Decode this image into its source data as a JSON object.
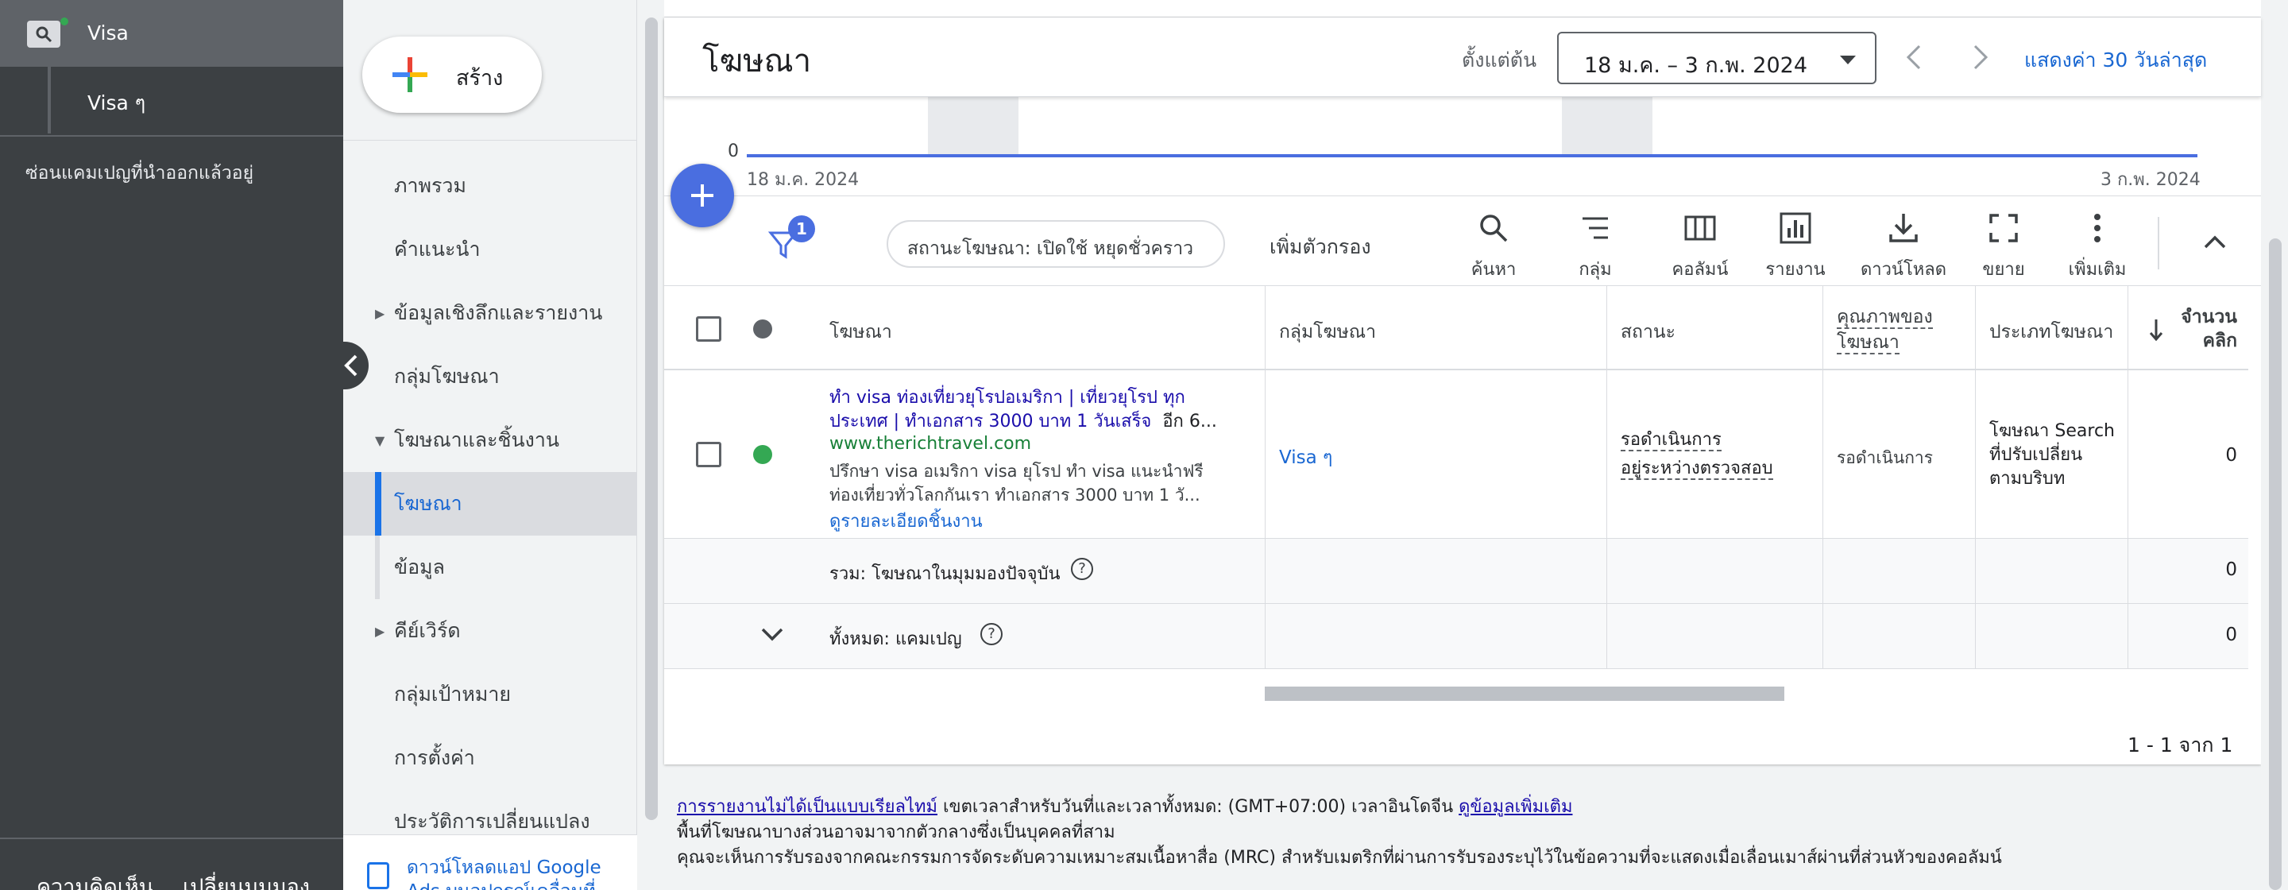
{
  "left_panel": {
    "campaign_label": "Visa",
    "adgroup_label": "Visa ๆ",
    "hide_removed": "ซ่อนแคมเปญที่นำออกแล้วอยู่",
    "feedback": "ความคิดเห็น",
    "switch_view": "เปลี่ยนมุมมอง"
  },
  "nav": {
    "create_label": "สร้าง",
    "items": [
      {
        "label": "ภาพรวม"
      },
      {
        "label": "คำแนะนำ"
      },
      {
        "label": "ข้อมูลเชิงลึกและรายงาน"
      },
      {
        "label": "กลุ่มโฆษณา"
      },
      {
        "label": "โฆษณาและชิ้นงาน"
      },
      {
        "label": "โฆษณา"
      },
      {
        "label": "ข้อมูล"
      },
      {
        "label": "คีย์เวิร์ด"
      },
      {
        "label": "กลุ่มเป้าหมาย"
      },
      {
        "label": "การตั้งค่า"
      },
      {
        "label": "ประวัติการเปลี่ยนแปลง"
      }
    ],
    "download_app": "ดาวน์โหลดแอป Google Ads บนอุปกรณ์เคลื่อนที่"
  },
  "header": {
    "title": "โฆษณา",
    "date_label": "ตั้งแต่ต้น",
    "date_range": "18 ม.ค. – 3 ก.พ. 2024",
    "last30": "แสดงค่า 30 วันล่าสุด"
  },
  "chart_data": {
    "type": "line",
    "x": [
      "18 ม.ค. 2024",
      "3 ก.พ. 2024"
    ],
    "series": [
      {
        "values": [
          0,
          0
        ]
      }
    ],
    "title": "",
    "ytick": "0",
    "start_label": "18 ม.ค. 2024",
    "end_label": "3 ก.พ. 2024"
  },
  "toolbar": {
    "filter_count": "1",
    "filter_chip": "สถานะโฆษณา: เปิดใช้ หยุดชั่วคราว",
    "add_filter": "เพิ่มตัวกรอง",
    "tools": [
      {
        "label": "ค้นหา",
        "icon": "search-icon"
      },
      {
        "label": "กลุ่ม",
        "icon": "segment-icon"
      },
      {
        "label": "คอลัมน์",
        "icon": "columns-icon"
      },
      {
        "label": "รายงาน",
        "icon": "reports-icon"
      },
      {
        "label": "ดาวน์โหลด",
        "icon": "download-icon"
      },
      {
        "label": "ขยาย",
        "icon": "expand-icon"
      },
      {
        "label": "เพิ่มเติม",
        "icon": "more-vert-icon"
      }
    ]
  },
  "table": {
    "headers": {
      "ad": "โฆษณา",
      "ad_group": "กลุ่มโฆษณา",
      "status": "สถานะ",
      "ad_strength_1": "คุณภาพของ",
      "ad_strength_2": "โฆษณา",
      "ad_type": "ประเภทโฆษณา",
      "clicks_1": "จำนวน",
      "clicks_2": "คลิก"
    },
    "ad_row": {
      "headline_1": "ทำ visa ท่องเที่ยวยุโรปอเมริกา | เที่ยวยุโรป ทุก",
      "headline_2": "ประเทศ | ทำเอกสาร 3000 บาท 1 วันเสร็จ",
      "headline_more": "อีก 6...",
      "url": "www.therichtravel.com",
      "desc_1": "ปรึกษา visa อเมริกา visa ยุโรป ทำ visa แนะนำฟรี",
      "desc_2": "ท่องเที่ยวทั่วโลกกันเรา ทำเอกสาร 3000 บาท 1 วั...",
      "details": "ดูรายละเอียดชิ้นงาน",
      "ad_group": "Visa ๆ",
      "status_1": "รอดำเนินการ",
      "status_2": "อยู่ระหว่างตรวจสอบ",
      "ad_strength": "รอดำเนินการ",
      "ad_type_1": "โฆษณา Search",
      "ad_type_2": "ที่ปรับเปลี่ยน",
      "ad_type_3": "ตามบริบท",
      "clicks": "0",
      "status_color": "#34a853"
    },
    "total_row": {
      "label": "รวม: โฆษณาในมุมมองปัจจุบัน",
      "clicks": "0"
    },
    "all_row": {
      "label": "ทั้งหมด: แคมเปญ",
      "clicks": "0"
    },
    "pagination": "1 - 1 จาก 1"
  },
  "footer": {
    "not_realtime": "การรายงานไม่ได้เป็นแบบเรียลไทม์",
    "timezone": " เขตเวลาสำหรับวันที่และเวลาทั้งหมด: (GMT+07:00) เวลาอินโดจีน ",
    "learn_more": "ดูข้อมูลเพิ่มเติม",
    "line2": "พื้นที่โฆษณาบางส่วนอาจมาจากตัวกลางซึ่งเป็นบุคคลที่สาม",
    "line3": "คุณจะเห็นการรับรองจากคณะกรรมการจัดระดับความเหมาะสมเนื้อหาสื่อ (MRC) สำหรับเมตริกที่ผ่านการรับรองระบุไว้ในข้อความที่จะแสดงเมื่อเลื่อนเมาส์ผ่านที่ส่วนหัวของคอลัมน์"
  },
  "colors": {
    "accent": "#1a73e8",
    "fab": "#4a6ee0",
    "status_enabled": "#34a853",
    "status_header": "#5f6368"
  }
}
